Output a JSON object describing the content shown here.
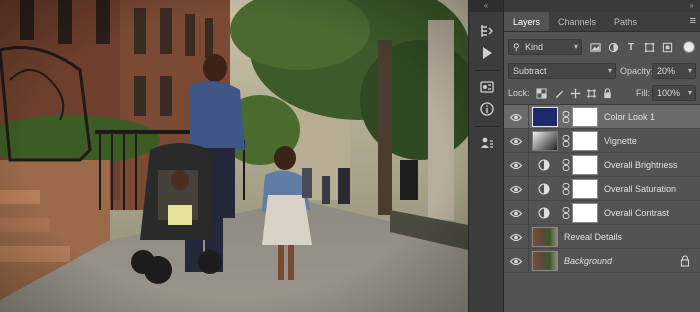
{
  "panel": {
    "collapse_left": "«",
    "collapse_right": "»",
    "tabs": [
      {
        "label": "Layers",
        "active": true
      },
      {
        "label": "Channels",
        "active": false
      },
      {
        "label": "Paths",
        "active": false
      }
    ],
    "menu_icon": "hamburger-menu-icon"
  },
  "filter": {
    "kind_label": "Kind",
    "search_icon": "search-icon",
    "filter_icons": [
      "image-filter-icon",
      "adjustment-filter-icon",
      "type-filter-icon",
      "shape-filter-icon",
      "smart-object-filter-icon"
    ],
    "toggle": "on"
  },
  "blend": {
    "mode": "Subtract",
    "opacity_label": "Opacity:",
    "opacity_value": "20%"
  },
  "locks": {
    "label": "Lock:",
    "icons": [
      "lock-transparent-pixels-icon",
      "lock-image-pixels-icon",
      "lock-position-icon",
      "lock-artboard-icon",
      "lock-all-icon"
    ],
    "fill_label": "Fill:",
    "fill_value": "100%"
  },
  "layers": [
    {
      "name": "Color Look 1",
      "type": "solid-color",
      "selected": true,
      "visible": true
    },
    {
      "name": "Vignette",
      "type": "gradient",
      "selected": false,
      "visible": true
    },
    {
      "name": "Overall Brightness",
      "type": "adjustment",
      "selected": false,
      "visible": true
    },
    {
      "name": "Overall Saturation",
      "type": "adjustment",
      "selected": false,
      "visible": true
    },
    {
      "name": "Overall Contrast",
      "type": "adjustment",
      "selected": false,
      "visible": true
    },
    {
      "name": "Reveal Details",
      "type": "pixel",
      "selected": false,
      "visible": true
    },
    {
      "name": "Background",
      "type": "pixel",
      "selected": false,
      "visible": true,
      "locked": true
    }
  ],
  "toolbar": {
    "icons": [
      "history-icon",
      "play-action-icon",
      "adjustments-panel-icon",
      "info-icon",
      "properties-icon"
    ]
  },
  "colors": {
    "accent_swatch": "#1c2a6b",
    "panel_bg": "#535353",
    "selected_row": "#6b6b6b"
  }
}
